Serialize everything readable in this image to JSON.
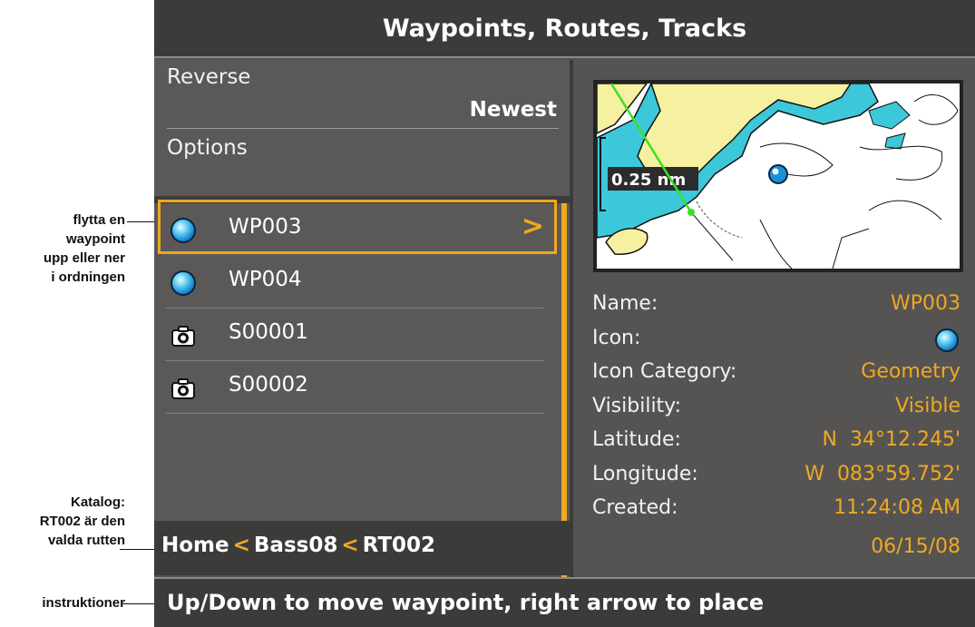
{
  "title": "Waypoints, Routes, Tracks",
  "sort": {
    "label": "Reverse",
    "value": "Newest"
  },
  "options_label": "Options",
  "list": [
    {
      "name": "WP003",
      "icon": "waypoint-ball-icon",
      "selected": true
    },
    {
      "name": "WP004",
      "icon": "waypoint-ball-icon",
      "selected": false
    },
    {
      "name": "S00001",
      "icon": "camera-icon",
      "selected": false
    },
    {
      "name": "S00002",
      "icon": "camera-icon",
      "selected": false
    }
  ],
  "selected_arrow": ">",
  "map": {
    "scale_label": "0.25 nm"
  },
  "details": {
    "name": {
      "label": "Name:",
      "value": "WP003"
    },
    "icon": {
      "label": "Icon:"
    },
    "icon_category": {
      "label": "Icon Category:",
      "value": "Geometry"
    },
    "visibility": {
      "label": "Visibility:",
      "value": "Visible"
    },
    "latitude": {
      "label": "Latitude:",
      "value": "N  34°12.245'"
    },
    "longitude": {
      "label": "Longitude:",
      "value": "W  083°59.752'"
    },
    "created": {
      "label": "Created:",
      "time": "11:24:08 AM",
      "date": "06/15/08"
    }
  },
  "breadcrumb": {
    "items": [
      "Home",
      "Bass08",
      "RT002"
    ],
    "separator": "<"
  },
  "instruction": "Up/Down to move waypoint, right arrow to place",
  "annotations": {
    "move": [
      "flytta en",
      "waypoint",
      "upp eller ner",
      "i ordningen"
    ],
    "catalog": [
      "Katalog:",
      "RT002 är den",
      "valda rutten"
    ],
    "instructions": [
      "instruktioner"
    ]
  },
  "colors": {
    "accent": "#f0a821",
    "background": "#555452",
    "bar": "#3b3b39",
    "text": "#ffffff"
  }
}
